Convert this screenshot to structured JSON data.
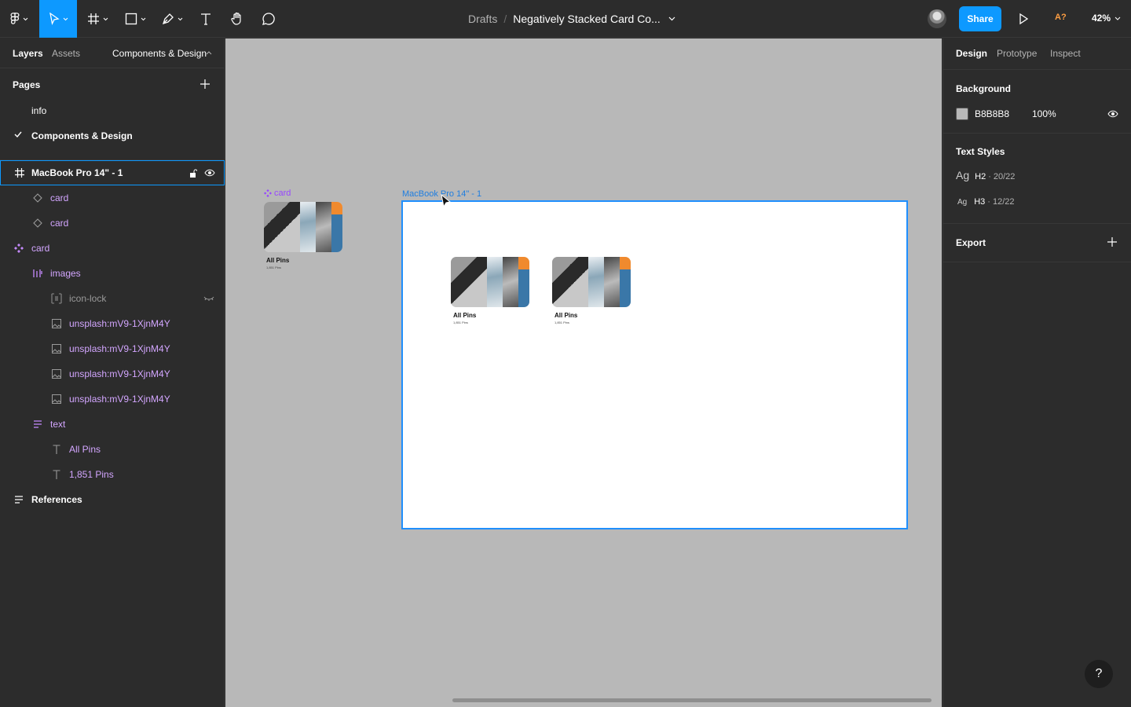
{
  "toolbar": {
    "breadcrumb": "Drafts",
    "separator": "/",
    "document_title": "Negatively Stacked Card Co...",
    "share_label": "Share",
    "collab_badge": "A?",
    "zoom": "42%"
  },
  "left_panel": {
    "tabs": [
      "Layers",
      "Assets",
      "Components & Design"
    ],
    "pages_heading": "Pages",
    "pages": [
      {
        "label": "info",
        "current": false
      },
      {
        "label": "Components & Design",
        "current": true
      }
    ],
    "layers": [
      {
        "label": "MacBook Pro 14\" - 1",
        "icon": "frame-icon",
        "selected": true
      },
      {
        "label": "card",
        "icon": "instance-icon"
      },
      {
        "label": "card",
        "icon": "instance-icon"
      },
      {
        "label": "card",
        "icon": "component-icon"
      },
      {
        "label": "images",
        "icon": "autolayout-horizontal-icon"
      },
      {
        "label": "icon-lock",
        "icon": "instance-icon",
        "hidden": true
      },
      {
        "label": "unsplash:mV9-1XjnM4Y",
        "icon": "image-icon"
      },
      {
        "label": "unsplash:mV9-1XjnM4Y",
        "icon": "image-icon"
      },
      {
        "label": "unsplash:mV9-1XjnM4Y",
        "icon": "image-icon"
      },
      {
        "label": "unsplash:mV9-1XjnM4Y",
        "icon": "image-icon"
      },
      {
        "label": "text",
        "icon": "autolayout-vertical-icon"
      },
      {
        "label": "All Pins",
        "icon": "text-icon"
      },
      {
        "label": "1,851 Pins",
        "icon": "text-icon"
      },
      {
        "label": "References",
        "icon": "autolayout-vertical-icon"
      }
    ]
  },
  "canvas": {
    "component_label": "card",
    "frame_label": "MacBook Pro 14\" - 1",
    "background": "#B8B8B8",
    "card": {
      "title": "All Pins",
      "subtitle": "1,851 Pins"
    }
  },
  "right_panel": {
    "tabs": [
      "Design",
      "Prototype",
      "Inspect"
    ],
    "background_heading": "Background",
    "background_hex": "B8B8B8",
    "background_opacity": "100%",
    "text_styles_heading": "Text Styles",
    "text_styles": [
      {
        "sample": "Ag",
        "name": "H2",
        "spec": "20/22"
      },
      {
        "sample": "Ag",
        "name": "H3",
        "spec": "12/22"
      }
    ],
    "export_heading": "Export",
    "help": "?"
  },
  "colors": {
    "accent": "#0d99ff",
    "component": "#9747ff",
    "component_layer_text": "#d3a6ff",
    "panel_bg": "#2c2c2c"
  }
}
